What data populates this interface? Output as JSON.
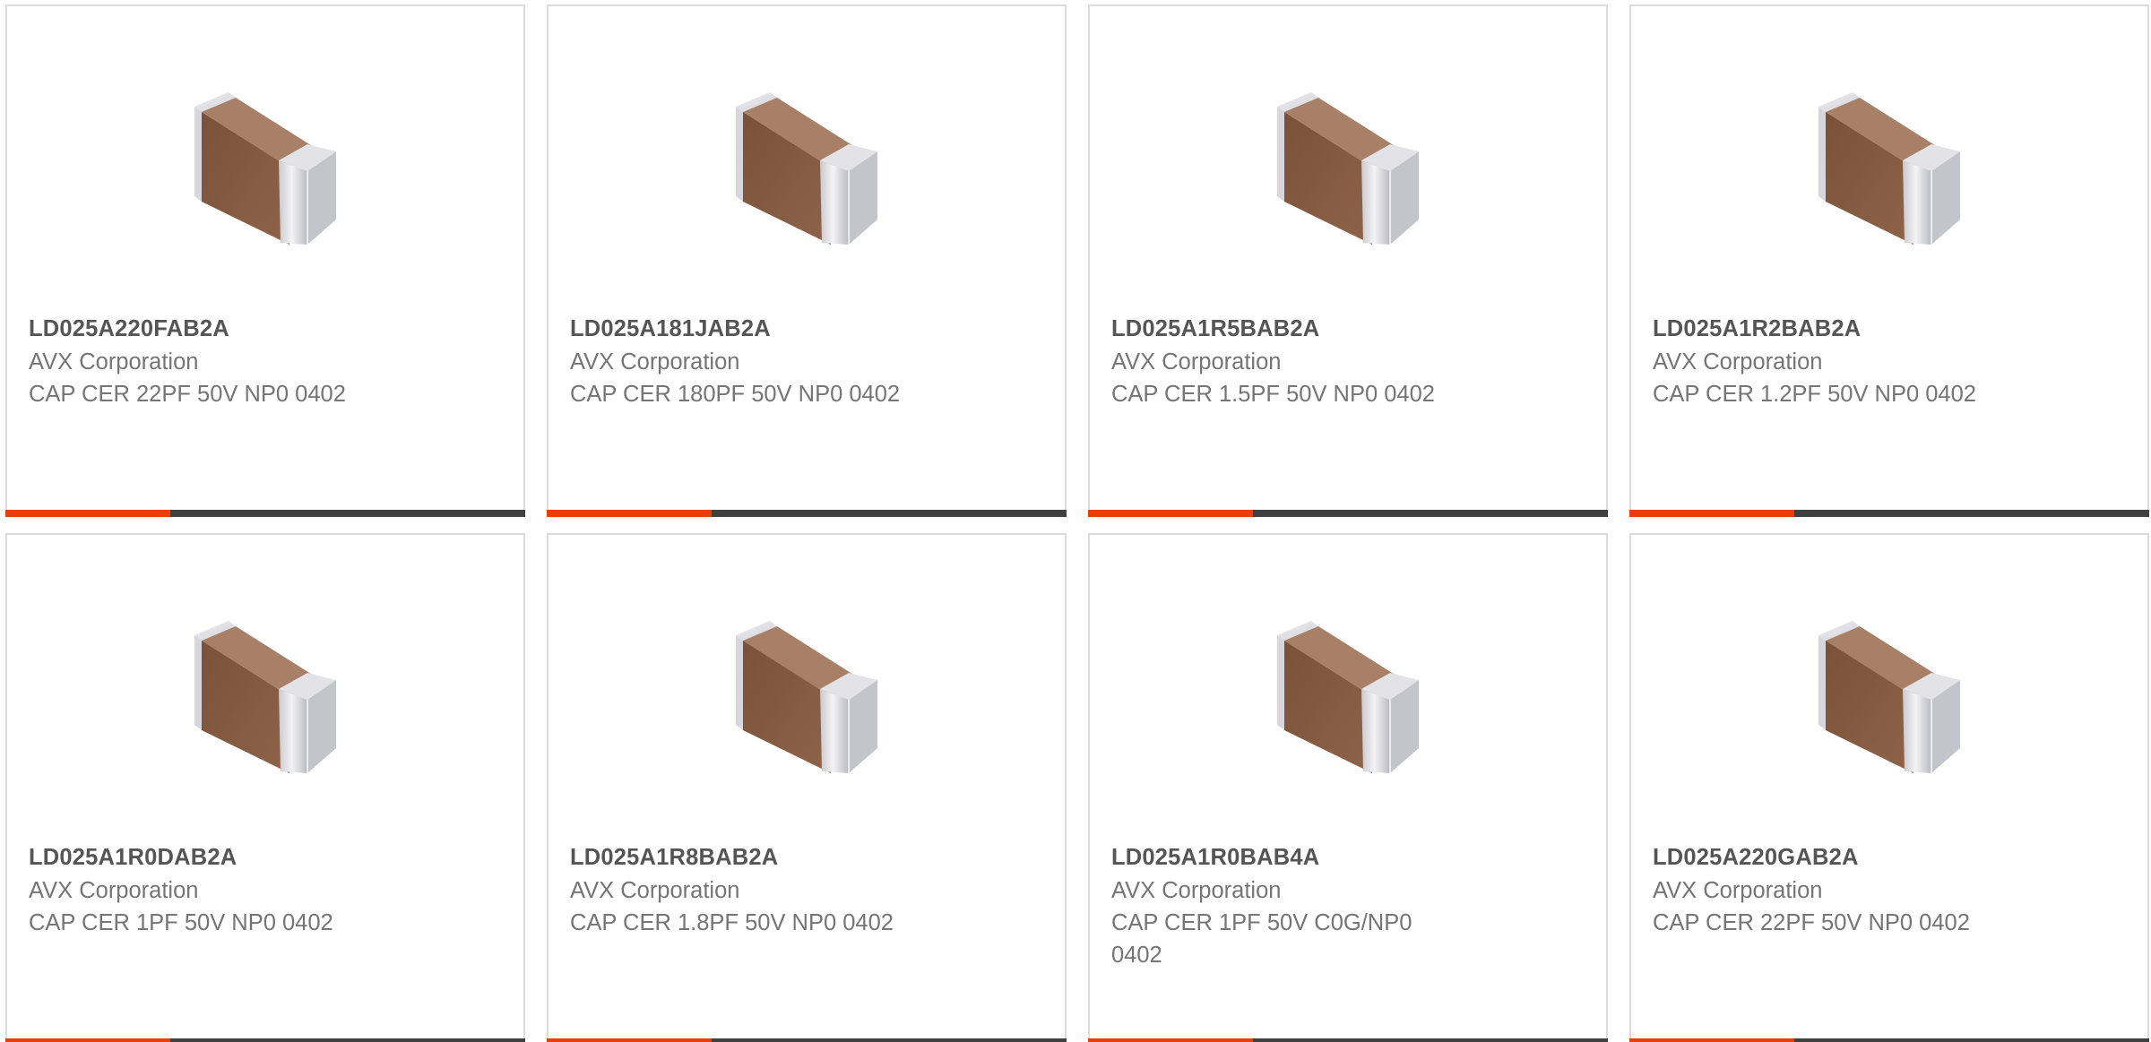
{
  "colors": {
    "card_border": "#dcdcdc",
    "part_text": "#555555",
    "secondary_text": "#757575",
    "bar_accent": "#e83e0b",
    "bar_base": "#404040",
    "capacitor_body": "#8b5e45",
    "capacitor_terminal": "#e6e6ea"
  },
  "products": [
    {
      "part_number": "LD025A220FAB2A",
      "manufacturer": "AVX Corporation",
      "description": "CAP CER 22PF 50V NP0 0402",
      "image_icon": "chip-capacitor-icon"
    },
    {
      "part_number": "LD025A181JAB2A",
      "manufacturer": "AVX Corporation",
      "description": "CAP CER 180PF 50V NP0 0402",
      "image_icon": "chip-capacitor-icon"
    },
    {
      "part_number": "LD025A1R5BAB2A",
      "manufacturer": "AVX Corporation",
      "description": "CAP CER 1.5PF 50V NP0 0402",
      "image_icon": "chip-capacitor-icon"
    },
    {
      "part_number": "LD025A1R2BAB2A",
      "manufacturer": "AVX Corporation",
      "description": "CAP CER 1.2PF 50V NP0 0402",
      "image_icon": "chip-capacitor-icon"
    },
    {
      "part_number": "LD025A1R0DAB2A",
      "manufacturer": "AVX Corporation",
      "description": "CAP CER 1PF 50V NP0 0402",
      "image_icon": "chip-capacitor-icon"
    },
    {
      "part_number": "LD025A1R8BAB2A",
      "manufacturer": "AVX Corporation",
      "description": "CAP CER 1.8PF 50V NP0 0402",
      "image_icon": "chip-capacitor-icon"
    },
    {
      "part_number": "LD025A1R0BAB4A",
      "manufacturer": "AVX Corporation",
      "description": "CAP CER 1PF 50V C0G/NP0 0402",
      "image_icon": "chip-capacitor-icon"
    },
    {
      "part_number": "LD025A220GAB2A",
      "manufacturer": "AVX Corporation",
      "description": "CAP CER 22PF 50V NP0 0402",
      "image_icon": "chip-capacitor-icon"
    }
  ]
}
